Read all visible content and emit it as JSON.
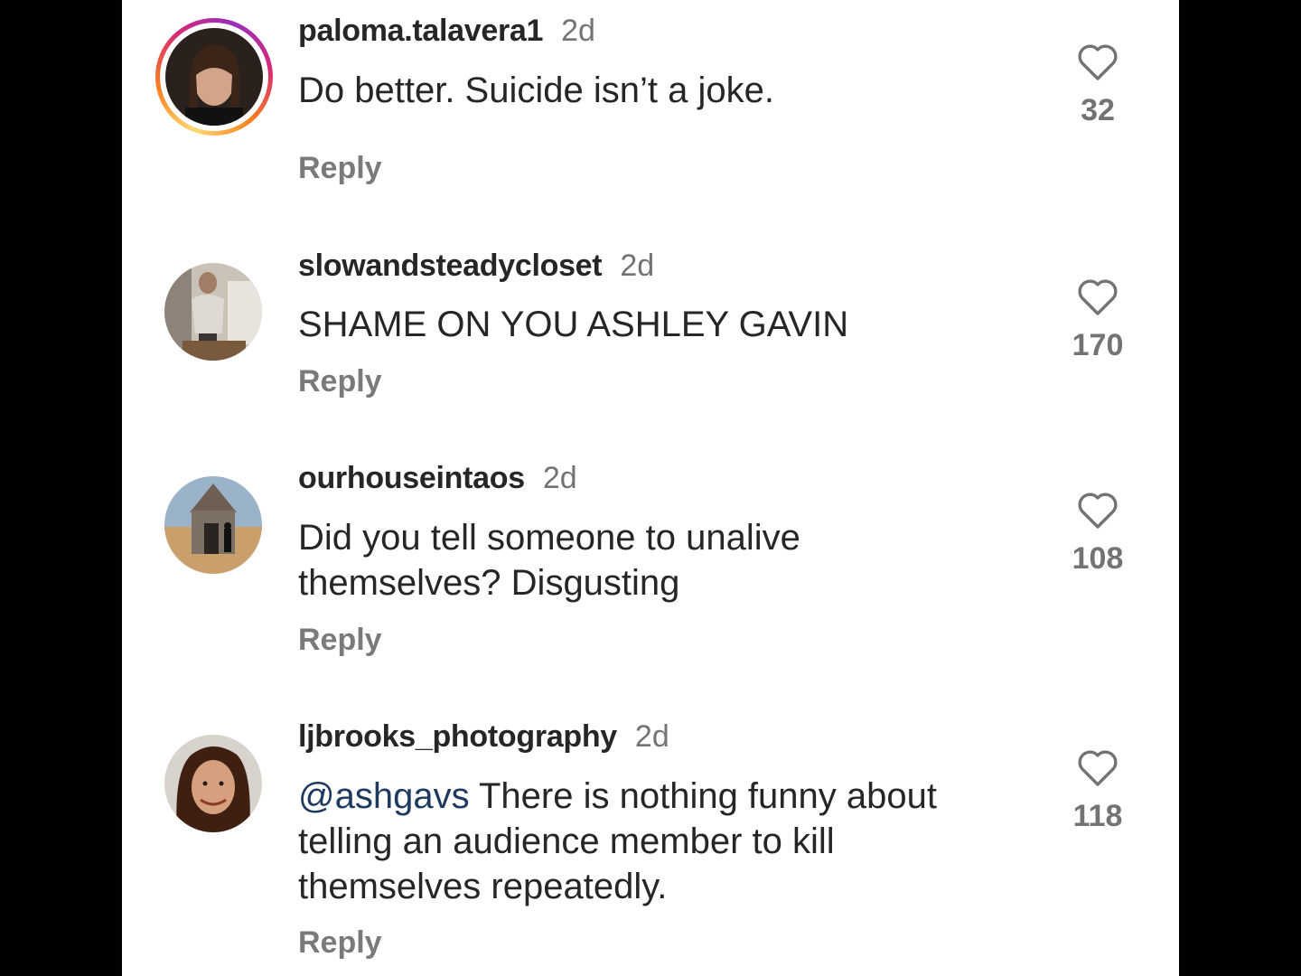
{
  "colors": {
    "text": "#262626",
    "secondary": "#737373",
    "mention": "#1f3a5f",
    "background": "#ffffff"
  },
  "comments": [
    {
      "username": "paloma.talavera1",
      "time": "2d",
      "text": "Do better. Suicide isn’t a joke.",
      "reply": "Reply",
      "likes": "32",
      "has_story": true
    },
    {
      "username": "slowandsteadycloset",
      "time": "2d",
      "text": "SHAME ON YOU ASHLEY GAVIN",
      "reply": "Reply",
      "likes": "170"
    },
    {
      "username": "ourhouseintaos",
      "time": "2d",
      "text_line1": "Did you tell someone to unalive",
      "text_line2": "themselves? Disgusting",
      "reply": "Reply",
      "likes": "108"
    },
    {
      "username": "ljbrooks_photography",
      "time": "2d",
      "mention": "@ashgavs",
      "text_line1": " There is nothing funny about",
      "text_line2": "telling an audience member to kill",
      "text_line3": "themselves repeatedly.",
      "reply": "Reply",
      "likes": "118"
    }
  ],
  "icons": {
    "like": "heart-outline-icon"
  }
}
